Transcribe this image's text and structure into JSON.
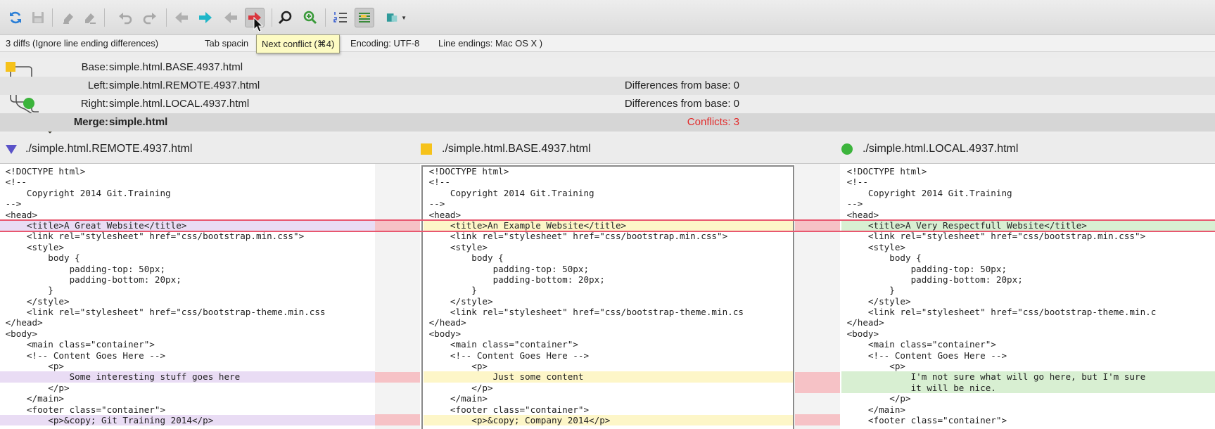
{
  "toolbar": {
    "buttons": [
      {
        "name": "refresh-icon",
        "color": "#2c7fd6"
      },
      {
        "name": "save-icon",
        "color": "#9a9a9a"
      },
      {
        "name": "resolve-left-icon",
        "color": "#9a9a9a"
      },
      {
        "name": "resolve-right-icon",
        "color": "#9a9a9a"
      },
      {
        "name": "undo-icon",
        "color": "#9a9a9a"
      },
      {
        "name": "redo-icon",
        "color": "#9a9a9a"
      },
      {
        "name": "previous-difference-icon",
        "color": "#9a9a9a"
      },
      {
        "name": "next-difference-icon",
        "color": "#1fb6c8"
      },
      {
        "name": "previous-conflict-icon",
        "color": "#9a9a9a"
      },
      {
        "name": "next-conflict-icon",
        "color": "#d9363e"
      },
      {
        "name": "find-icon",
        "color": "#222222"
      },
      {
        "name": "find-next-icon",
        "color": "#3a9a3a"
      },
      {
        "name": "line-numbers-icon",
        "color": "#3a5fcf"
      },
      {
        "name": "show-whitespace-icon",
        "color": "#3a8a3a"
      },
      {
        "name": "merge-mode-icon",
        "color": "#2f9a9a"
      }
    ],
    "tooltip": "Next conflict (⌘4)"
  },
  "status": {
    "diffs": "3 diffs (Ignore line ending differences)",
    "tab_spacing": "Tab spacin",
    "encoding": "Encoding: UTF-8",
    "line_endings": "Line endings: Mac OS X )"
  },
  "files": {
    "base_label": "Base:",
    "base_file": "simple.html.BASE.4937.html",
    "left_label": "Left:",
    "left_file": "simple.html.REMOTE.4937.html",
    "left_diff": "Differences from base: 0",
    "right_label": "Right:",
    "right_file": "simple.html.LOCAL.4937.html",
    "right_diff": "Differences from base: 0",
    "merge_label": "Merge:",
    "merge_file": "simple.html",
    "conflicts": "Conflicts: 3"
  },
  "colors": {
    "base": "#f6c21a",
    "remote": "#5a52c8",
    "local": "#3cb43c",
    "conflict": "#e22b2b"
  },
  "panes": {
    "remote": {
      "path": "./simple.html.REMOTE.4937.html",
      "lines": [
        "<!DOCTYPE html>",
        "<!--",
        "    Copyright 2014 Git.Training",
        "-->",
        "<head>",
        "    <title>A Great Website</title>",
        "    <link rel=\"stylesheet\" href=\"css/bootstrap.min.css\">",
        "    <style>",
        "        body {",
        "            padding-top: 50px;",
        "            padding-bottom: 20px;",
        "        }",
        "    </style>",
        "    <link rel=\"stylesheet\" href=\"css/bootstrap-theme.min.css",
        "</head>",
        "<body>",
        "    <main class=\"container\">",
        "    <!-- Content Goes Here -->",
        "        <p>",
        "            Some interesting stuff goes here",
        "        </p>",
        "    </main>",
        "    <footer class=\"container\">",
        "        <p>&copy; Git Training 2014</p>"
      ]
    },
    "base": {
      "path": "./simple.html.BASE.4937.html",
      "lines": [
        "<!DOCTYPE html>",
        "<!--",
        "    Copyright 2014 Git.Training",
        "-->",
        "<head>",
        "    <title>An Example Website</title>",
        "    <link rel=\"stylesheet\" href=\"css/bootstrap.min.css\">",
        "    <style>",
        "        body {",
        "            padding-top: 50px;",
        "            padding-bottom: 20px;",
        "        }",
        "    </style>",
        "    <link rel=\"stylesheet\" href=\"css/bootstrap-theme.min.cs",
        "</head>",
        "<body>",
        "    <main class=\"container\">",
        "    <!-- Content Goes Here -->",
        "        <p>",
        "            Just some content",
        "        </p>",
        "    </main>",
        "    <footer class=\"container\">",
        "        <p>&copy; Company 2014</p>"
      ]
    },
    "local": {
      "path": "./simple.html.LOCAL.4937.html",
      "lines": [
        "<!DOCTYPE html>",
        "<!--",
        "    Copyright 2014 Git.Training",
        "-->",
        "<head>",
        "    <title>A Very Respectfull Website</title>",
        "    <link rel=\"stylesheet\" href=\"css/bootstrap.min.css\">",
        "    <style>",
        "        body {",
        "            padding-top: 50px;",
        "            padding-bottom: 20px;",
        "        }",
        "    </style>",
        "    <link rel=\"stylesheet\" href=\"css/bootstrap-theme.min.c",
        "</head>",
        "<body>",
        "    <main class=\"container\">",
        "    <!-- Content Goes Here -->",
        "        <p>",
        "            I'm not sure what will go here, but I'm sure",
        "            it will be nice.",
        "        </p>",
        "    </main>",
        "    <footer class=\"container\">"
      ]
    }
  }
}
